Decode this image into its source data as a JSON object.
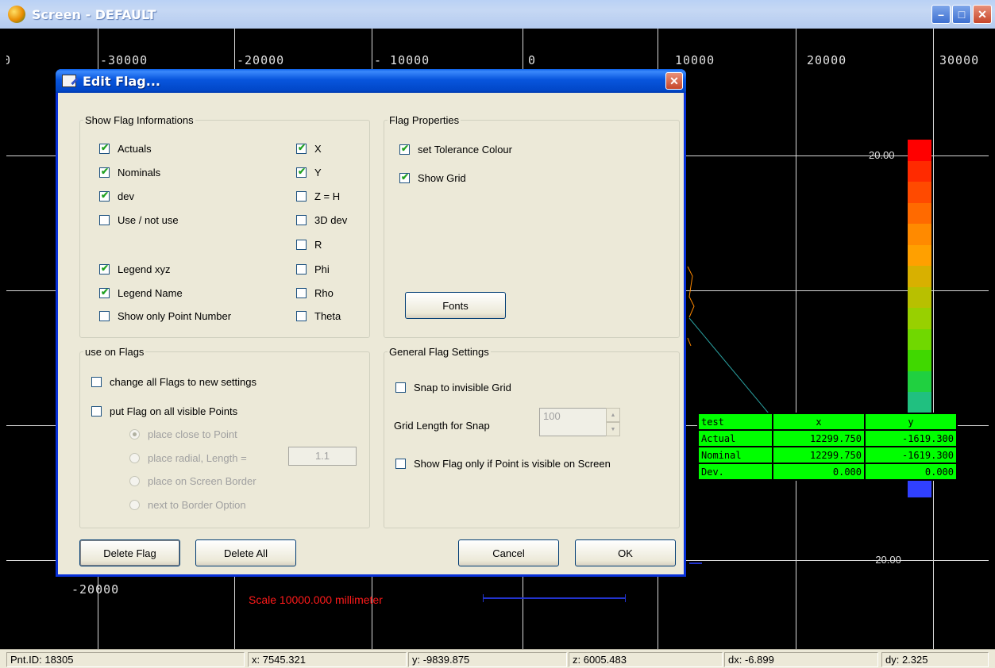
{
  "window": {
    "title": "Screen - DEFAULT"
  },
  "plot": {
    "x_axis_labels": [
      "0",
      "-30000",
      "-20000",
      "- 10000",
      "0",
      "10000",
      "20000",
      "30000"
    ],
    "y_axis_label": "-20000",
    "scale_text": "Scale 10000.000 millimeter",
    "legend_top": "20.00",
    "legend_bottom": "-20.00",
    "legend_colors": [
      "#ff0000",
      "#ff2a00",
      "#ff4a00",
      "#ff6a00",
      "#ff8a00",
      "#ffa000",
      "#d8b000",
      "#b8c000",
      "#98d000",
      "#70d800",
      "#40d800",
      "#20d040",
      "#20c080",
      "#20b0b0",
      "#0000ff",
      "#2020ff",
      "#3040ff"
    ]
  },
  "flag_table": {
    "header": [
      "test",
      "x",
      "y"
    ],
    "rows": [
      [
        "Actual",
        "12299.750",
        "-1619.300"
      ],
      [
        "Nominal",
        "12299.750",
        "-1619.300"
      ],
      [
        "Dev.",
        "0.000",
        "0.000"
      ]
    ]
  },
  "status": {
    "pnt": "Pnt.ID: 18305",
    "x": "x: 7545.321",
    "y": "y: -9839.875",
    "z": "z: 6005.483",
    "dx": "dx: -6.899",
    "dy": "dy: 2.325"
  },
  "dialog": {
    "title": "Edit Flag...",
    "show_info": {
      "legend": "Show Flag Informations",
      "left": [
        {
          "label": "Actuals",
          "checked": true
        },
        {
          "label": "Nominals",
          "checked": true
        },
        {
          "label": "dev",
          "checked": true
        },
        {
          "label": "Use / not use",
          "checked": false
        },
        {
          "label": "Legend xyz",
          "checked": true
        },
        {
          "label": "Legend Name",
          "checked": true
        },
        {
          "label": "Show only Point Number",
          "checked": false
        }
      ],
      "right": [
        {
          "label": "X",
          "checked": true
        },
        {
          "label": "Y",
          "checked": true
        },
        {
          "label": "Z = H",
          "checked": false
        },
        {
          "label": "3D dev",
          "checked": false
        },
        {
          "label": "R",
          "checked": false
        },
        {
          "label": "Phi",
          "checked": false
        },
        {
          "label": "Rho",
          "checked": false
        },
        {
          "label": "Theta",
          "checked": false
        }
      ]
    },
    "flag_props": {
      "legend": "Flag Properties",
      "set_tol": "set Tolerance Colour",
      "show_grid": "Show Grid",
      "fonts_btn": "Fonts"
    },
    "use_on": {
      "legend": "use on Flags",
      "change_all": "change all Flags to new settings",
      "put_flag": "put Flag on all visible Points",
      "r1": "place close to Point",
      "r2": "place radial, Length =",
      "r2_value": "1.1",
      "r3": "place on Screen Border",
      "r4": "next to Border Option"
    },
    "general": {
      "legend": "General Flag Settings",
      "snap": "Snap to invisible Grid",
      "grid_len_label": "Grid Length for Snap",
      "grid_len_value": "100",
      "show_only": "Show Flag only if Point is visible on Screen"
    },
    "buttons": {
      "delete_flag": "Delete Flag",
      "delete_all": "Delete All",
      "cancel": "Cancel",
      "ok": "OK"
    }
  }
}
